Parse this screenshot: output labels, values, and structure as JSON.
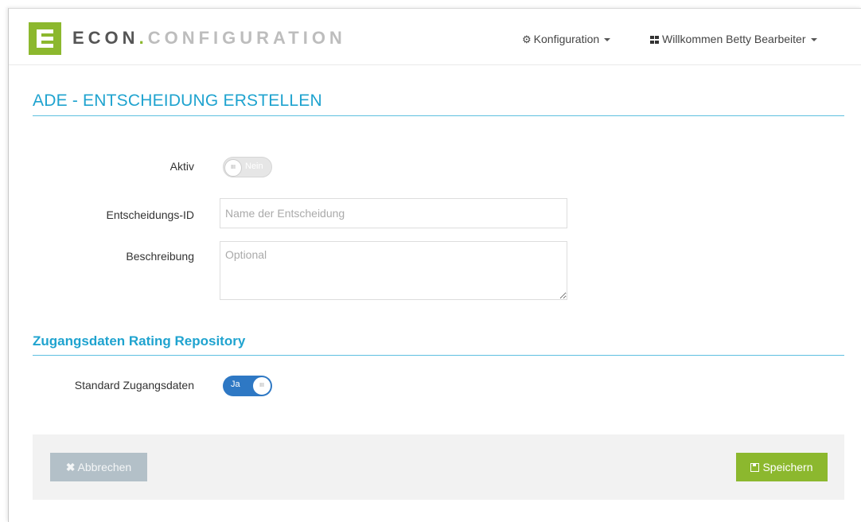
{
  "header": {
    "brand_first": "ECON",
    "brand_dot": ".",
    "brand_second": "CONFIGURATION",
    "nav_config_label": "Konfiguration",
    "nav_user_label": "Willkommen Betty Bearbeiter"
  },
  "page": {
    "title": "ADE - ENTSCHEIDUNG ERSTELLEN"
  },
  "form": {
    "aktiv_label": "Aktiv",
    "aktiv_state": "Nein",
    "aktiv_knob": "III",
    "id_label": "Entscheidungs-ID",
    "id_placeholder": "Name der Entscheidung",
    "id_value": "",
    "desc_label": "Beschreibung",
    "desc_placeholder": "Optional",
    "desc_value": ""
  },
  "section": {
    "title": "Zugangsdaten Rating Repository",
    "standard_label": "Standard Zugangsdaten",
    "standard_state": "Ja",
    "standard_knob": "III"
  },
  "footer": {
    "cancel_label": "Abbrechen",
    "save_label": "Speichern"
  },
  "colors": {
    "accent_blue": "#1fa3cf",
    "brand_green": "#8cb82e",
    "toggle_on": "#2e78c4",
    "cancel_gray": "#b3c0c8"
  },
  "icons": [
    "logo-e-icon",
    "gear-icon",
    "grid-icon",
    "chevron-down-icon",
    "times-icon",
    "floppy-disk-icon"
  ]
}
